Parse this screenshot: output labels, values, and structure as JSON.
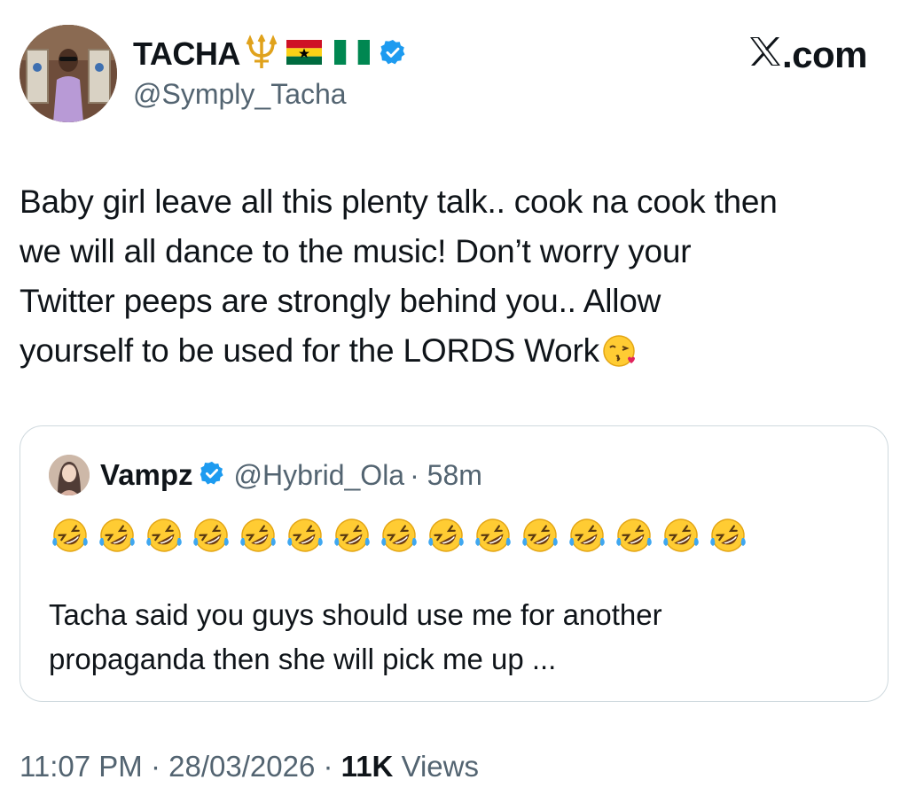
{
  "author": {
    "display_name": "TACHA",
    "trident_symbol": "🔱",
    "flags": [
      "ghana-flag",
      "nigeria-flag"
    ],
    "verified": true,
    "handle": "@Symply_Tacha",
    "avatar": "profile-photo"
  },
  "brand": {
    "text": ".com",
    "logo": "x-logo"
  },
  "tweet": {
    "lines": [
      "Baby girl leave all this plenty talk.. cook na cook then",
      "we will all dance to the music! Don’t worry your",
      "Twitter peeps are strongly behind you.. Allow",
      "yourself to be used for the LORDS Work"
    ],
    "end_emoji": "face-blowing-a-kiss"
  },
  "quoted_tweet": {
    "display_name": "Vampz",
    "verified": true,
    "handle": "@Hybrid_Ola",
    "time": "· 58m",
    "emoji": "rolling-on-the-floor-laughing",
    "emoji_count": 15,
    "lines": [
      "Tacha said you guys should use me for another",
      "propaganda then she will pick me up ..."
    ]
  },
  "footer": {
    "time": "11:07 PM",
    "date": "28/03/2026",
    "views_count": "11K",
    "views_label": "Views",
    "separator": "·"
  },
  "colors": {
    "text": "#0f1419",
    "secondary": "#536471",
    "verified_blue": "#1d9bf0",
    "border": "#cfd9de"
  }
}
